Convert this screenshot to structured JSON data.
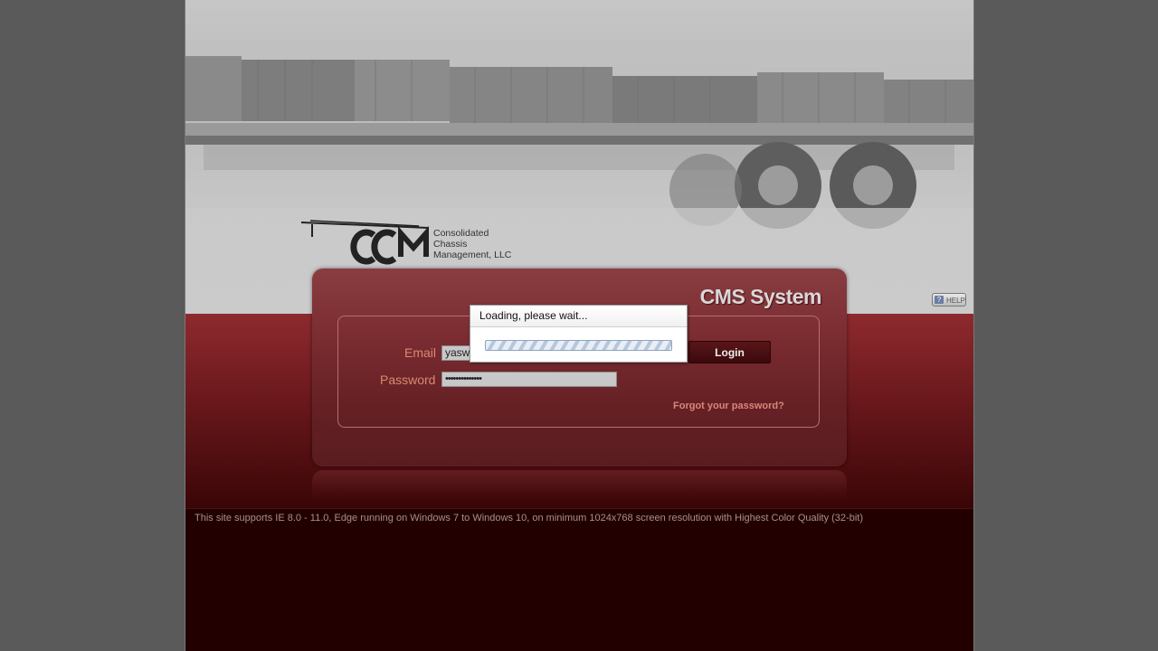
{
  "logo": {
    "mark": "CCM",
    "company": "Consolidated\nChassis\nManagement, LLC"
  },
  "help": {
    "label": "HELP",
    "icon": "help-icon"
  },
  "panel": {
    "title": "CMS System",
    "email_label": "Email",
    "email_value": "yasw",
    "password_label": "Password",
    "password_value": "••••••••••••••",
    "login_label": "Login",
    "forgot_label": "Forgot your password?"
  },
  "loading": {
    "title": "Loading, please wait..."
  },
  "footer": {
    "notice": "This site supports IE 8.0 - 11.0, Edge running on Windows 7 to Windows 10, on minimum 1024x768 screen resolution with Highest Color Quality (32-bit)"
  },
  "colors": {
    "accent_red": "#8e2a2e",
    "dark_bg": "#220000",
    "label_orange": "#d88a70"
  }
}
